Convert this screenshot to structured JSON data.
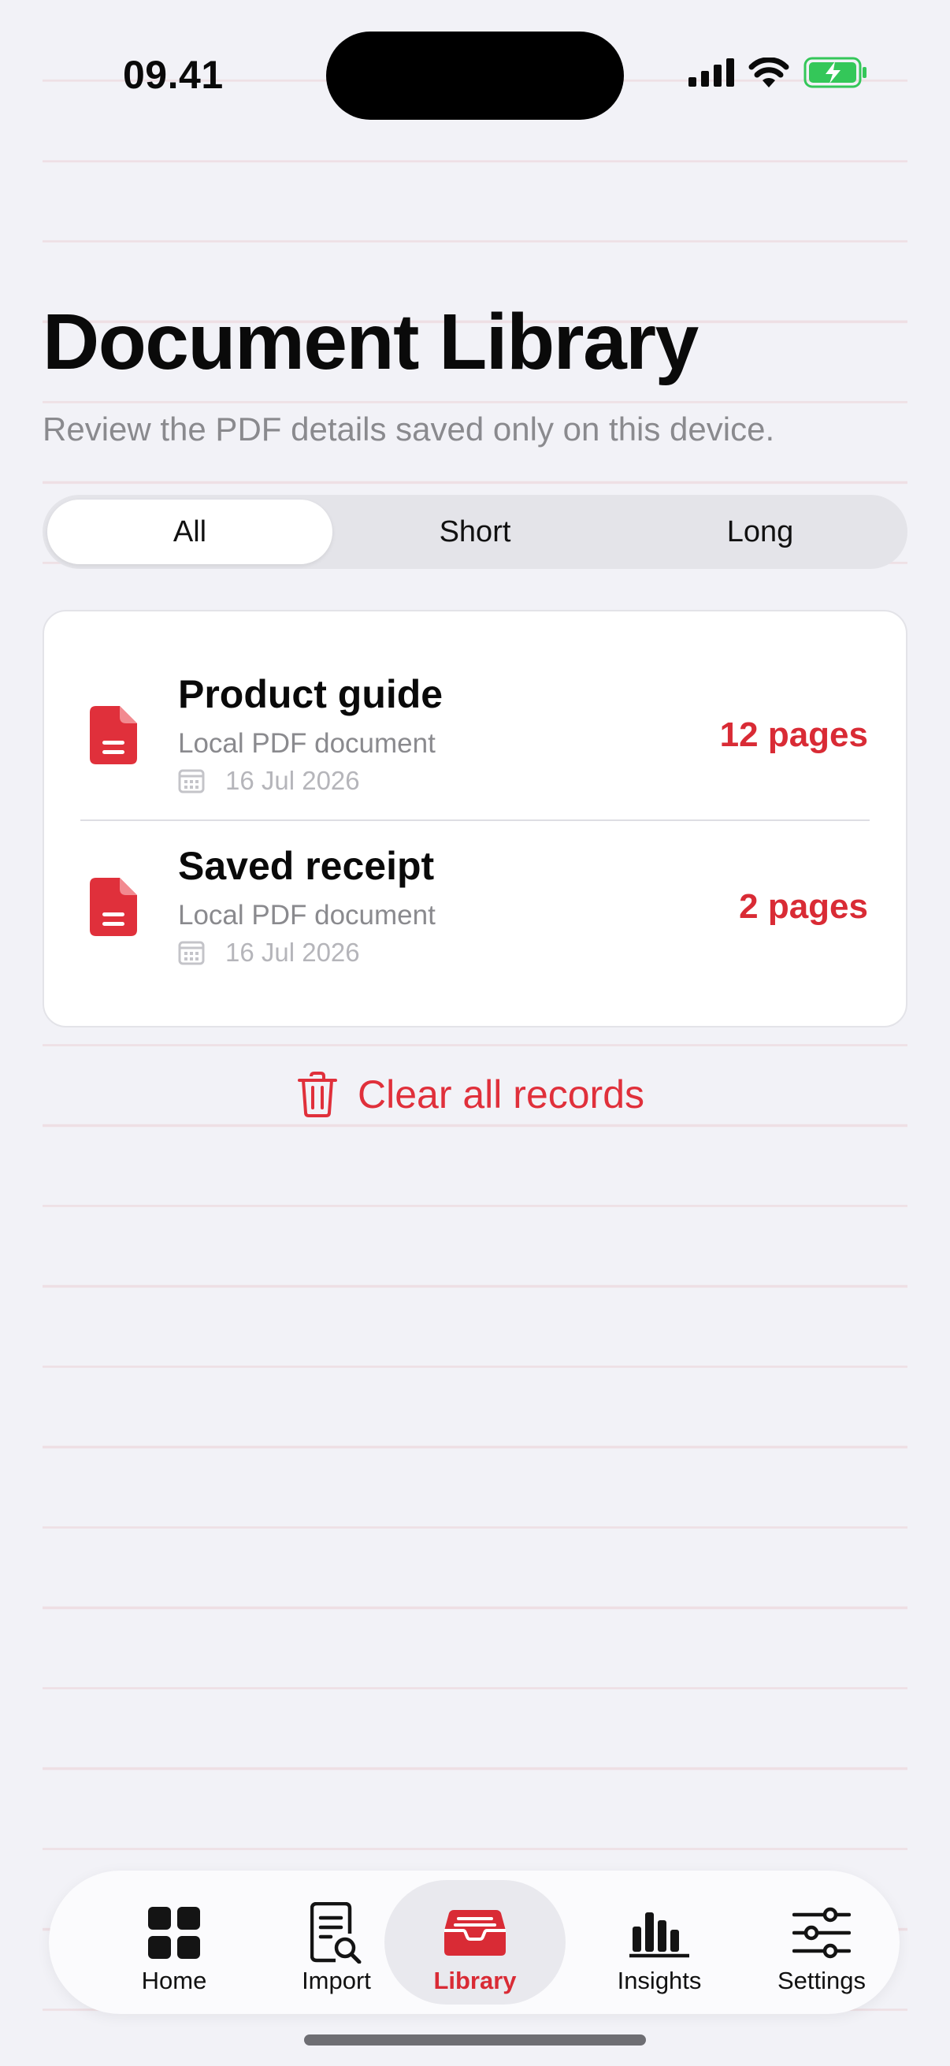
{
  "status_bar": {
    "time": "09.41"
  },
  "header": {
    "title": "Document Library",
    "subtitle": "Review the PDF details saved only on this device."
  },
  "filter": {
    "segments": [
      "All",
      "Short",
      "Long"
    ],
    "selected": "All"
  },
  "documents": [
    {
      "title": "Product guide",
      "type": "Local PDF document",
      "date": "16 Jul 2026",
      "pages": "12 pages"
    },
    {
      "title": "Saved receipt",
      "type": "Local PDF document",
      "date": "16 Jul 2026",
      "pages": "2 pages"
    }
  ],
  "actions": {
    "clear_all": "Clear all records"
  },
  "tab_bar": {
    "items": [
      {
        "label": "Home",
        "icon": "grid-icon"
      },
      {
        "label": "Import",
        "icon": "document-search-icon"
      },
      {
        "label": "Library",
        "icon": "tray-icon"
      },
      {
        "label": "Insights",
        "icon": "bar-chart-icon"
      },
      {
        "label": "Settings",
        "icon": "sliders-icon"
      }
    ],
    "active": "Library"
  },
  "colors": {
    "accent": "#d92b35",
    "background": "#f2f2f7",
    "battery": "#34c759"
  }
}
